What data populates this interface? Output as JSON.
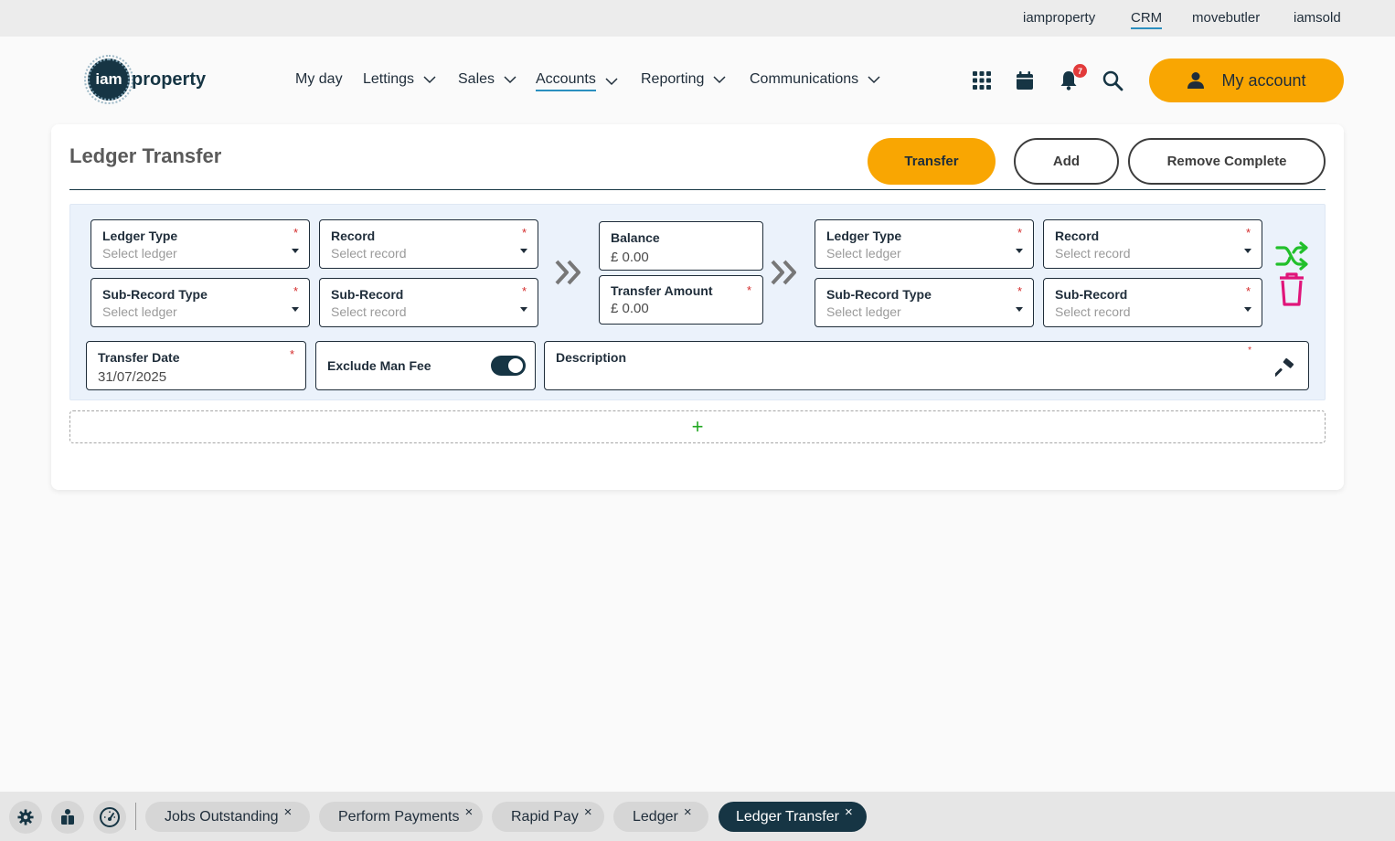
{
  "topbar": {
    "links": [
      "iamproperty",
      "CRM",
      "movebutler",
      "iamsold"
    ]
  },
  "logo": {
    "circle_text": "iam",
    "word": "property"
  },
  "nav": {
    "my_day": "My day",
    "lettings": "Lettings",
    "sales": "Sales",
    "accounts": "Accounts",
    "reporting": "Reporting",
    "communications": "Communications"
  },
  "header": {
    "notification_count": "7",
    "my_account": "My account"
  },
  "page": {
    "title": "Ledger Transfer",
    "transfer_btn": "Transfer",
    "add_btn": "Add",
    "remove_btn": "Remove Complete"
  },
  "form": {
    "left": {
      "ledger_type": {
        "label": "Ledger Type",
        "placeholder": "Select ledger",
        "required": "*"
      },
      "record": {
        "label": "Record",
        "placeholder": "Select record",
        "required": "*"
      },
      "sub_record_type": {
        "label": "Sub-Record Type",
        "placeholder": "Select ledger",
        "required": "*"
      },
      "sub_record": {
        "label": "Sub-Record",
        "placeholder": "Select record",
        "required": "*"
      }
    },
    "balance": {
      "label": "Balance",
      "value": "£ 0.00"
    },
    "transfer_amount": {
      "label": "Transfer Amount",
      "value": "£ 0.00",
      "required": "*"
    },
    "right": {
      "ledger_type": {
        "label": "Ledger Type",
        "placeholder": "Select ledger",
        "required": "*"
      },
      "record": {
        "label": "Record",
        "placeholder": "Select record",
        "required": "*"
      },
      "sub_record_type": {
        "label": "Sub-Record Type",
        "placeholder": "Select ledger",
        "required": "*"
      },
      "sub_record": {
        "label": "Sub-Record",
        "placeholder": "Select record",
        "required": "*"
      }
    },
    "transfer_date": {
      "label": "Transfer Date",
      "value": "31/07/2025",
      "required": "*"
    },
    "exclude_man_fee": {
      "label": "Exclude Man Fee",
      "checked": true
    },
    "description": {
      "label": "Description",
      "required": "*"
    },
    "add_row": "+"
  },
  "colors": {
    "accent": "#f9a602",
    "navy": "#163544",
    "required": "#d42c2c",
    "shuffle": "#22c02b",
    "delete": "#e0157a"
  },
  "bottom_tabs": [
    {
      "label": "Jobs Outstanding",
      "close": "×"
    },
    {
      "label": "Perform Payments",
      "close": "×"
    },
    {
      "label": "Rapid Pay",
      "close": "×"
    },
    {
      "label": "Ledger",
      "close": "×"
    },
    {
      "label": "Ledger Transfer",
      "close": "×"
    }
  ]
}
